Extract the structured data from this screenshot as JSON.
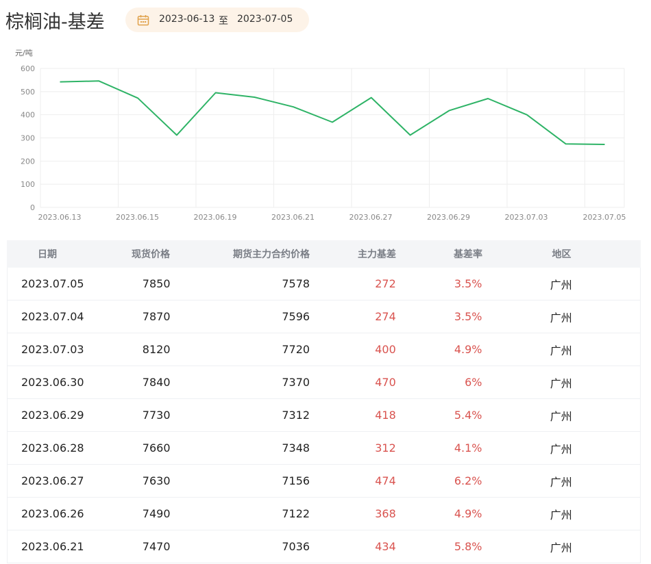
{
  "header": {
    "title": "棕榈油-基差",
    "date_start": "2023-06-13",
    "date_sep": "至",
    "date_end": "2023-07-05"
  },
  "chart_data": {
    "type": "line",
    "ylabel": "元/吨",
    "ylim": [
      0,
      600
    ],
    "yticks": [
      0,
      100,
      200,
      300,
      400,
      500,
      600
    ],
    "xtick_labels": [
      "2023.06.13",
      "2023.06.15",
      "2023.06.19",
      "2023.06.21",
      "2023.06.27",
      "2023.06.29",
      "2023.07.03",
      "2023.07.05"
    ],
    "x": [
      "2023.06.13",
      "2023.06.14",
      "2023.06.15",
      "2023.06.16",
      "2023.06.19",
      "2023.06.20",
      "2023.06.21",
      "2023.06.26",
      "2023.06.27",
      "2023.06.28",
      "2023.06.29",
      "2023.06.30",
      "2023.07.03",
      "2023.07.04",
      "2023.07.05"
    ],
    "series": [
      {
        "values": [
          542,
          546,
          472,
          312,
          495,
          476,
          434,
          368,
          474,
          312,
          418,
          470,
          400,
          274,
          272
        ],
        "color": "#2eb366"
      }
    ],
    "grid": true
  },
  "table": {
    "headers": [
      "日期",
      "现货价格",
      "期货主力合约价格",
      "主力基差",
      "基差率",
      "地区"
    ],
    "rows": [
      [
        "2023.07.05",
        "7850",
        "7578",
        "272",
        "3.5%",
        "广州"
      ],
      [
        "2023.07.04",
        "7870",
        "7596",
        "274",
        "3.5%",
        "广州"
      ],
      [
        "2023.07.03",
        "8120",
        "7720",
        "400",
        "4.9%",
        "广州"
      ],
      [
        "2023.06.30",
        "7840",
        "7370",
        "470",
        "6%",
        "广州"
      ],
      [
        "2023.06.29",
        "7730",
        "7312",
        "418",
        "5.4%",
        "广州"
      ],
      [
        "2023.06.28",
        "7660",
        "7348",
        "312",
        "4.1%",
        "广州"
      ],
      [
        "2023.06.27",
        "7630",
        "7156",
        "474",
        "6.2%",
        "广州"
      ],
      [
        "2023.06.26",
        "7490",
        "7122",
        "368",
        "4.9%",
        "广州"
      ],
      [
        "2023.06.21",
        "7470",
        "7036",
        "434",
        "5.8%",
        "广州"
      ]
    ]
  },
  "colors": {
    "accent_red": "#d9534f",
    "line_green": "#2eb366",
    "date_pill_bg": "#fdf3e8",
    "calendar_icon": "#e0a14a"
  },
  "icons": {
    "date_picker": "calendar-icon"
  }
}
